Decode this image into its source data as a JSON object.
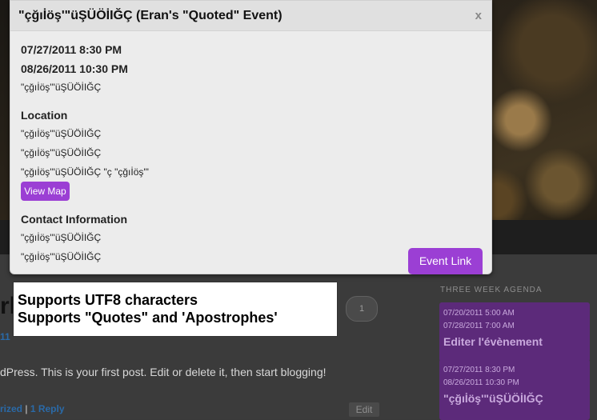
{
  "popup": {
    "title": "\"çğıİöş'\"üŞÜÖİIĞÇ (Eran's \"Quoted\" Event)",
    "close": "x",
    "start": "07/27/2011 8:30 PM",
    "end": "08/26/2011 10:30 PM",
    "description": "\"çğıİöş'\"üŞÜÖİIĞÇ",
    "location_heading": "Location",
    "location_lines": [
      "\"çğıİöş'\"üŞÜÖİIĞÇ",
      "\"çğıİöş'\"üŞÜÖİIĞÇ",
      "\"çğıİöş'\"üŞÜÖİIĞÇ \"ç \"çğıİöş'\""
    ],
    "view_map": "View Map",
    "contact_heading": "Contact Information",
    "contact_lines": [
      "\"çğıİöş'\"üŞÜÖİIĞÇ",
      "\"çğıİöş'\"üŞÜÖİIĞÇ"
    ],
    "event_link": "Event Link"
  },
  "callout": {
    "line1": "Supports UTF8 characters",
    "line2": "Supports \"Quotes\" and 'Apostrophes'"
  },
  "post": {
    "title_fragment": "rl",
    "date_fragment": "11",
    "excerpt": "dPress. This is your first post. Edit or delete it, then start blogging!",
    "category_fragment": "rized",
    "separator": "|",
    "replies": "1 Reply",
    "comment_count": "1",
    "edit": "Edit"
  },
  "sidebar": {
    "heading": "THREE WEEK AGENDA",
    "agenda": [
      {
        "start": "07/20/2011 5:00 AM",
        "end": "07/28/2011 7:00 AM",
        "title": "Editer l'évènement"
      },
      {
        "start": "07/27/2011 8:30 PM",
        "end": "08/26/2011 10:30 PM",
        "title": "\"çğıİöş'\"üŞÜÖİIĞÇ"
      }
    ]
  },
  "colors": {
    "accent_purple": "#9b3fd4",
    "agenda_purple": "#5c2a7a",
    "link_blue": "#2a6aa8"
  }
}
